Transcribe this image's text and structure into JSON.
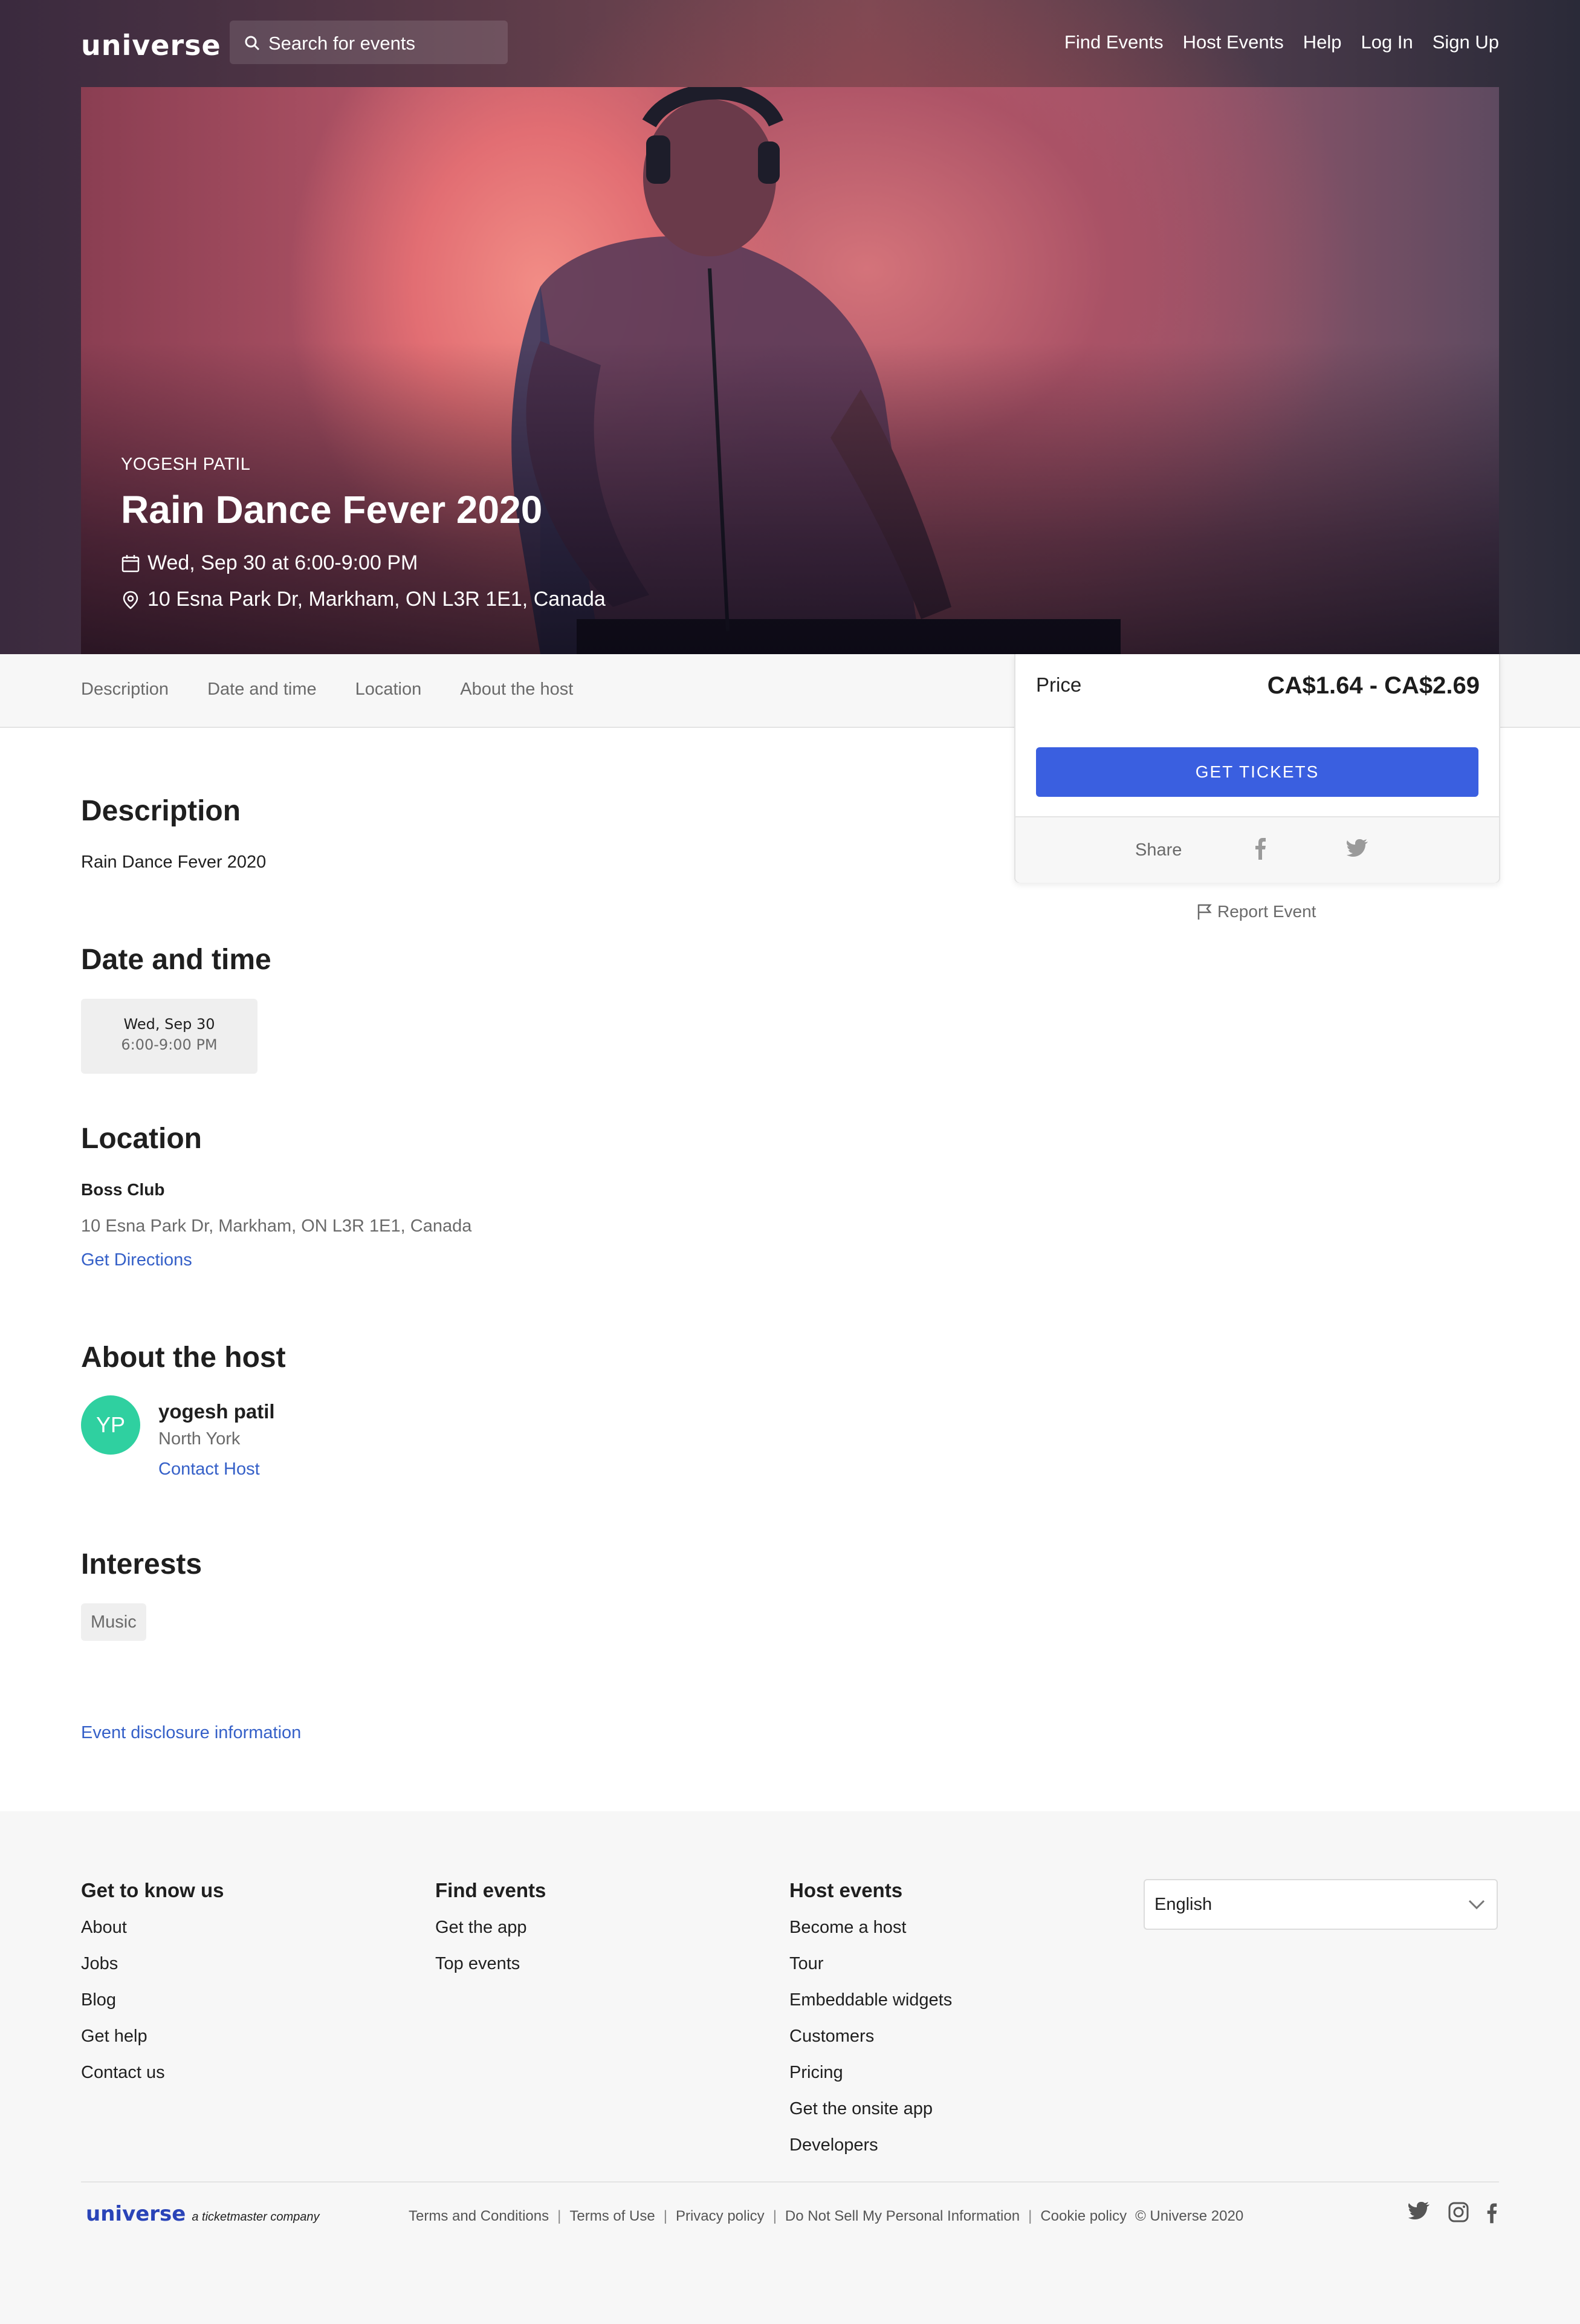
{
  "header": {
    "logo": "universe",
    "search_placeholder": "Search for events",
    "nav": [
      "Find Events",
      "Host Events",
      "Help",
      "Log In",
      "Sign Up"
    ]
  },
  "hero": {
    "host": "YOGESH PATIL",
    "title": "Rain Dance Fever 2020",
    "datetime": "Wed, Sep 30 at 6:00-9:00 PM",
    "address": "10 Esna Park Dr, Markham, ON L3R 1E1, Canada",
    "icons": [
      "calendar-icon",
      "map-pin-icon"
    ]
  },
  "subnav": [
    "Description",
    "Date and time",
    "Location",
    "About the host"
  ],
  "price_card": {
    "label": "Price",
    "value": "CA$1.64 - CA$2.69",
    "button": "GET TICKETS",
    "share_label": "Share",
    "share_icons": [
      "facebook-icon",
      "twitter-icon"
    ],
    "report": "Report Event",
    "accent": "#3a5fe0"
  },
  "description": {
    "heading": "Description",
    "text": "Rain Dance Fever 2020"
  },
  "date_time": {
    "heading": "Date and time",
    "day": "Wed, Sep 30",
    "time": "6:00-9:00 PM"
  },
  "location": {
    "heading": "Location",
    "venue": "Boss Club",
    "address": "10 Esna Park Dr, Markham, ON L3R 1E1, Canada",
    "directions": "Get Directions"
  },
  "host": {
    "heading": "About the host",
    "initials": "YP",
    "name": "yogesh patil",
    "city": "North York",
    "contact": "Contact Host",
    "avatar_color": "#2fd0a0"
  },
  "interests": {
    "heading": "Interests",
    "tags": [
      "Music"
    ]
  },
  "disclosure": "Event disclosure information",
  "footer": {
    "columns": [
      {
        "heading": "Get to know us",
        "items": [
          "About",
          "Jobs",
          "Blog",
          "Get help",
          "Contact us"
        ]
      },
      {
        "heading": "Find events",
        "items": [
          "Get the app",
          "Top events"
        ]
      },
      {
        "heading": "Host events",
        "items": [
          "Become a host",
          "Tour",
          "Embeddable widgets",
          "Customers",
          "Pricing",
          "Get the onsite app",
          "Developers"
        ]
      }
    ],
    "language": "English",
    "logo": "universe",
    "logo_tagline": "a ticketmaster company",
    "links": [
      "Terms and Conditions",
      "Terms of Use",
      "Privacy policy",
      "Do Not Sell My Personal Information",
      "Cookie policy"
    ],
    "copyright": "© Universe 2020",
    "social_icons": [
      "twitter-icon",
      "instagram-icon",
      "facebook-icon"
    ]
  }
}
